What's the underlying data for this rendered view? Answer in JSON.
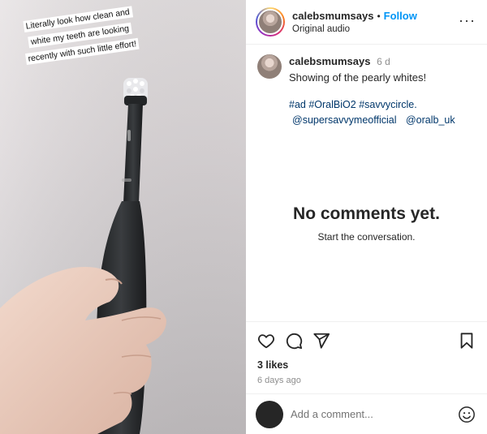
{
  "media": {
    "overlay_lines": [
      "Literally look how clean and",
      "white my teeth are looking",
      "recently with such little effort!"
    ]
  },
  "header": {
    "username": "calebsmumsays",
    "separator": "•",
    "follow_label": "Follow",
    "audio_label": "Original audio",
    "more_icon": "more-horizontal-icon"
  },
  "post": {
    "username": "calebsmumsays",
    "time_since": "6 d",
    "caption": "Showing of the pearly whites!",
    "hashtags": [
      "#ad",
      "#OralBiO2",
      "#savvycircle."
    ],
    "mentions": [
      "@supersavvymeofficial",
      "@oralb_uk"
    ]
  },
  "comments_empty": {
    "title": "No comments yet.",
    "subtitle": "Start the conversation."
  },
  "actions": {
    "icons": [
      "heart-icon",
      "comment-icon",
      "share-icon",
      "bookmark-icon"
    ],
    "likes": "3 likes",
    "date": "6 days ago"
  },
  "comment_input": {
    "placeholder": "Add a comment...",
    "emoji_icon": "emoji-icon"
  },
  "colors": {
    "accent": "#0095f6",
    "hashtag": "#00376b",
    "muted": "#8e8e8e"
  }
}
